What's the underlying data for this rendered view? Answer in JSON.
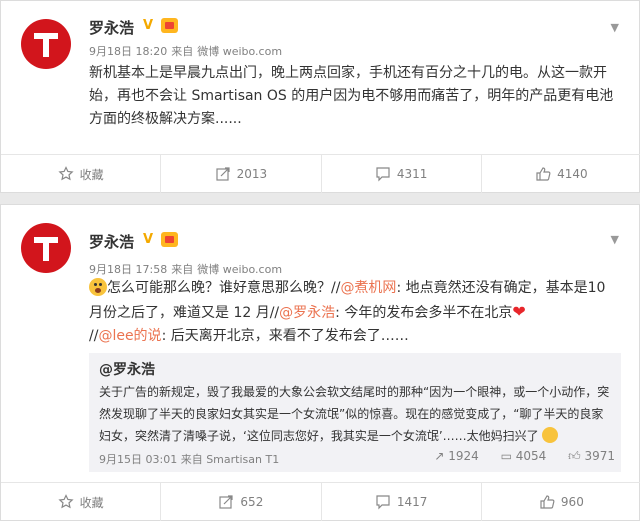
{
  "post1": {
    "author": "罗永浩",
    "meta": {
      "date": "9月18日 18:20",
      "source_prefix": "来自",
      "source": "微博 weibo.com"
    },
    "text": "新机基本上是早晨九点出门，晚上两点回家，手机还有百分之十几的电。从这一款开始，再也不会让 Smartisan OS 的用户因为电不够用而痛苦了，明年的产品更有电池方面的终极解决方案......",
    "actions": {
      "favorite": "收藏",
      "repost": "2013",
      "comment": "4311",
      "like": "4140"
    }
  },
  "post2": {
    "author": "罗永浩",
    "meta": {
      "date": "9月18日 17:58",
      "source_prefix": "来自",
      "source": "微博 weibo.com"
    },
    "text_parts": {
      "p1": "怎么可能那么晚？谁好意思那么晚？//",
      "m1": "@煮机网",
      "p2": ": 地点竟然还没有确定，基本是10 月份之后了，难道又是 12 月//",
      "m2": "@罗永浩",
      "p3": ": 今年的发布会多半不在北京",
      "p4": "//",
      "m3": "@lee的说",
      "p5": ": 后天离开北京，来看不了发布会了……"
    },
    "repost": {
      "author": "@罗永浩",
      "text": "关于广告的新规定，毁了我最爱的大象公会软文结尾时的那种“因为一个眼神，或一个小动作，突然发现聊了半天的良家妇女其实是一个女流氓”似的惊喜。现在的感觉变成了，“聊了半天的良家妇女，突然清了清嗓子说，‘这位同志您好，我其实是一个女流氓’……太他妈扫兴了",
      "meta": {
        "date": "9月15日 03:01",
        "source_prefix": "来自",
        "source": "Smartisan T1"
      },
      "actions": {
        "repost": "1924",
        "comment": "4054",
        "like": "3971"
      }
    },
    "actions": {
      "favorite": "收藏",
      "repost": "652",
      "comment": "1417",
      "like": "960"
    }
  },
  "colors": {
    "accent": "#eb7350",
    "avatar": "#d2151c",
    "meta": "#808080"
  }
}
